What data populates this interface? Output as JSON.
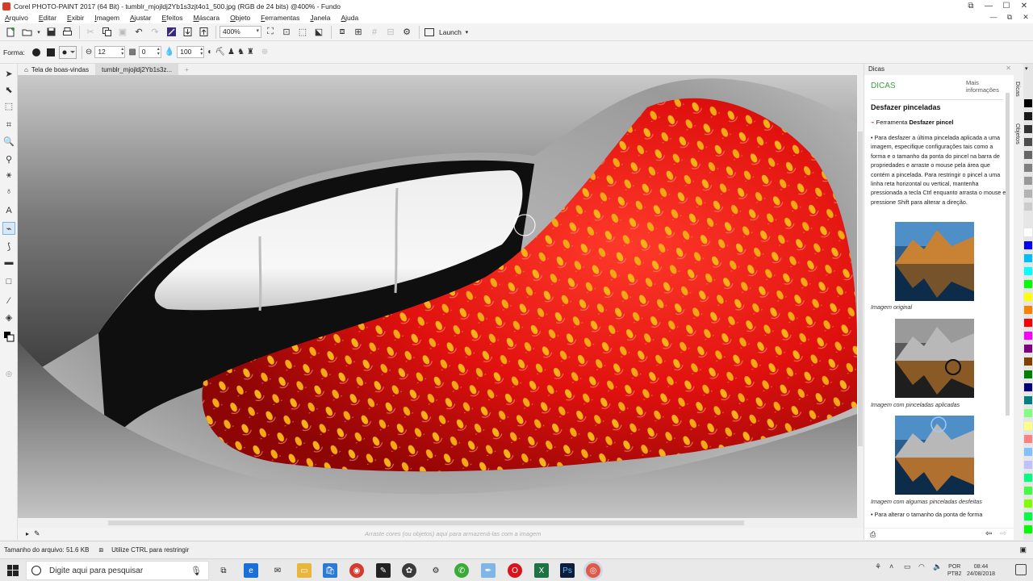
{
  "window": {
    "title": "Corel PHOTO-PAINT 2017 (64 Bit) - tumblr_mjojldj2Yb1s3zjt4o1_500.jpg (RGB de 24 bits) @400% - Fundo",
    "controls": [
      "restore-down",
      "minimize",
      "maximize",
      "close"
    ]
  },
  "menu": [
    "Arquivo",
    "Editar",
    "Exibir",
    "Imagem",
    "Ajustar",
    "Efeitos",
    "Máscara",
    "Objeto",
    "Ferramentas",
    "Janela",
    "Ajuda"
  ],
  "toolbar": {
    "zoom": "400%",
    "launch_label": "Launch"
  },
  "propbar": {
    "shape_label": "Forma:",
    "size_value": "12",
    "transparency_value": "0",
    "opacity_value": "100"
  },
  "tabs": {
    "welcome": "Tela de boas-vindas",
    "document": "tumblr_mjojldj2Yb1s3z..."
  },
  "canvas": {
    "color_tray_hint": "Arraste cores (ou objetos) aqui para armazená-las com a imagem"
  },
  "docker": {
    "header": "Dicas",
    "title": "DICAS",
    "more_info": "Mais informações",
    "heading": "Desfazer pinceladas",
    "tool_prefix": "Ferramenta",
    "tool_name": "Desfazer pincel",
    "body": "• Para desfazer a última pincelada aplicada a uma imagem, especifique configurações tais como a forma e o tamanho da ponta do pincel na barra de propriedades e arraste o mouse pela área que contém a pincelada. Para restringir o pincel a uma linha reta horizontal ou vertical, mantenha pressionada a tecla Ctrl enquanto arrasta o mouse e pressione Shift para alterar a direção.",
    "captions": [
      "Imagem original",
      "Imagem com pinceladas aplicadas",
      "Imagem com algumas pinceladas desfeitas"
    ],
    "footer": "• Para alterar o tamanho da ponta de forma"
  },
  "side_tabs": [
    "Dicas",
    "Objetos"
  ],
  "palette": [
    "#000000",
    "#1a1a1a",
    "#333333",
    "#4d4d4d",
    "#666666",
    "#808080",
    "#999999",
    "#b3b3b3",
    "#cccccc",
    "#e6e6e6",
    "#ffffff",
    "#0000ff",
    "#00bfff",
    "#00ffff",
    "#00ff00",
    "#ffff00",
    "#ff8000",
    "#ff0000",
    "#ff00ff",
    "#800080",
    "#804000",
    "#008000",
    "#000080",
    "#008080",
    "#80ff80",
    "#ffff80",
    "#ff8080",
    "#80c0ff",
    "#c0c0ff",
    "#00ff80",
    "#40ff40",
    "#80ff00",
    "#00ff40",
    "#00ff00"
  ],
  "status": {
    "file_size": "Tamanho do arquivo: 51.6 KB",
    "hint": "Utilize CTRL para restringir"
  },
  "taskbar": {
    "search_placeholder": "Digite aqui para pesquisar",
    "lang_line1": "POR",
    "lang_line2": "PTB2",
    "time": "08:44",
    "date": "24/08/2018"
  }
}
